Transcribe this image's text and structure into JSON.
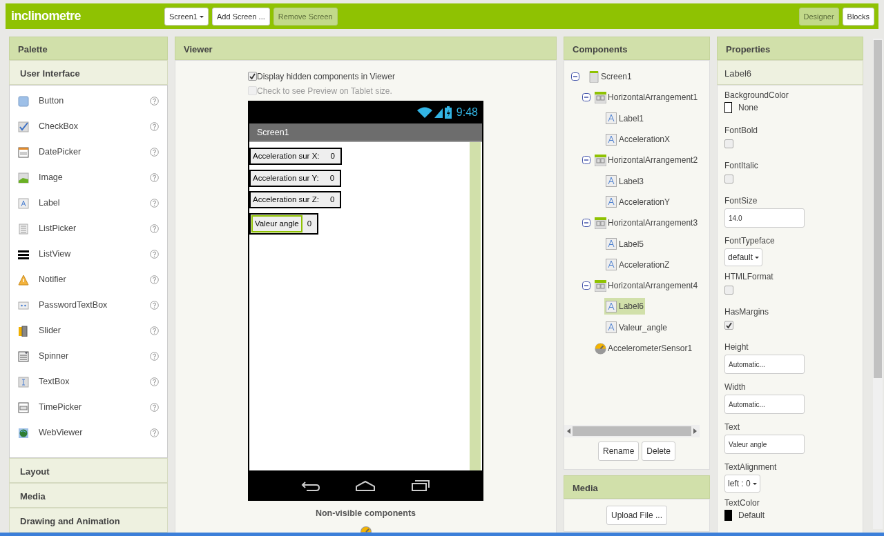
{
  "app_title": "inclinometre",
  "toolbar": {
    "screen_dropdown": "Screen1",
    "buttons": [
      {
        "label": "Add Screen ...",
        "disabled": false
      },
      {
        "label": "Remove Screen",
        "disabled": true
      }
    ],
    "views": [
      {
        "label": "Designer",
        "selected": true
      },
      {
        "label": "Blocks",
        "selected": false
      }
    ]
  },
  "palette": {
    "title": "Palette",
    "open_category": "User Interface",
    "items": [
      {
        "label": "Button"
      },
      {
        "label": "CheckBox"
      },
      {
        "label": "DatePicker"
      },
      {
        "label": "Image"
      },
      {
        "label": "Label"
      },
      {
        "label": "ListPicker"
      },
      {
        "label": "ListView"
      },
      {
        "label": "Notifier"
      },
      {
        "label": "PasswordTextBox"
      },
      {
        "label": "Slider"
      },
      {
        "label": "Spinner"
      },
      {
        "label": "TextBox"
      },
      {
        "label": "TimePicker"
      },
      {
        "label": "WebViewer"
      }
    ],
    "categories": [
      "Layout",
      "Media",
      "Drawing and Animation"
    ]
  },
  "viewer": {
    "title": "Viewer",
    "options": [
      {
        "label": "Display hidden components in Viewer",
        "checked": true,
        "disabled": false
      },
      {
        "label": "Check to see Preview on Tablet size.",
        "checked": false,
        "disabled": true
      }
    ],
    "phone": {
      "time": "9:48",
      "screen_title": "Screen1",
      "rows": [
        {
          "label": "Acceleration sur X:",
          "value": "0",
          "selected": false
        },
        {
          "label": "Acceleration sur Y:",
          "value": "0",
          "selected": false
        },
        {
          "label": "Acceleration sur Z:",
          "value": "0",
          "selected": false
        },
        {
          "label": "Valeur angle",
          "value": "0",
          "selected": true
        }
      ]
    },
    "nonvisible_title": "Non-visible components"
  },
  "components": {
    "title": "Components",
    "tree": [
      {
        "name": "Screen1",
        "kind": "screen",
        "expanded": true,
        "selected": false,
        "children": [
          {
            "name": "HorizontalArrangement1",
            "kind": "arrangement",
            "expanded": true,
            "selected": false,
            "children": [
              {
                "name": "Label1",
                "kind": "label",
                "selected": false
              },
              {
                "name": "AccelerationX",
                "kind": "label",
                "selected": false
              }
            ]
          },
          {
            "name": "HorizontalArrangement2",
            "kind": "arrangement",
            "expanded": true,
            "selected": false,
            "children": [
              {
                "name": "Label3",
                "kind": "label",
                "selected": false
              },
              {
                "name": "AccelerationY",
                "kind": "label",
                "selected": false
              }
            ]
          },
          {
            "name": "HorizontalArrangement3",
            "kind": "arrangement",
            "expanded": true,
            "selected": false,
            "children": [
              {
                "name": "Label5",
                "kind": "label",
                "selected": false
              },
              {
                "name": "AccelerationZ",
                "kind": "label",
                "selected": false
              }
            ]
          },
          {
            "name": "HorizontalArrangement4",
            "kind": "arrangement",
            "expanded": true,
            "selected": false,
            "children": [
              {
                "name": "Label6",
                "kind": "label",
                "selected": true
              },
              {
                "name": "Valeur_angle",
                "kind": "label",
                "selected": false
              }
            ]
          },
          {
            "name": "AccelerometerSensor1",
            "kind": "sensor",
            "selected": false
          }
        ]
      }
    ],
    "buttons": [
      "Rename",
      "Delete"
    ]
  },
  "media": {
    "title": "Media",
    "button": "Upload File ..."
  },
  "properties": {
    "title": "Properties",
    "component": "Label6",
    "items": [
      {
        "name": "BackgroundColor",
        "kind": "color",
        "value": "None",
        "color": "#ffffff"
      },
      {
        "name": "FontBold",
        "kind": "checkbox",
        "checked": false
      },
      {
        "name": "FontItalic",
        "kind": "checkbox",
        "checked": false
      },
      {
        "name": "FontSize",
        "kind": "text",
        "value": "14.0"
      },
      {
        "name": "FontTypeface",
        "kind": "dropdown",
        "value": "default"
      },
      {
        "name": "HTMLFormat",
        "kind": "checkbox",
        "checked": false
      },
      {
        "name": "HasMargins",
        "kind": "checkbox",
        "checked": true
      },
      {
        "name": "Height",
        "kind": "text",
        "value": "Automatic..."
      },
      {
        "name": "Width",
        "kind": "text",
        "value": "Automatic..."
      },
      {
        "name": "Text",
        "kind": "text",
        "value": "Valeur angle"
      },
      {
        "name": "TextAlignment",
        "kind": "dropdown",
        "value": "left : 0"
      },
      {
        "name": "TextColor",
        "kind": "color",
        "value": "Default",
        "color": "#000000"
      }
    ]
  }
}
